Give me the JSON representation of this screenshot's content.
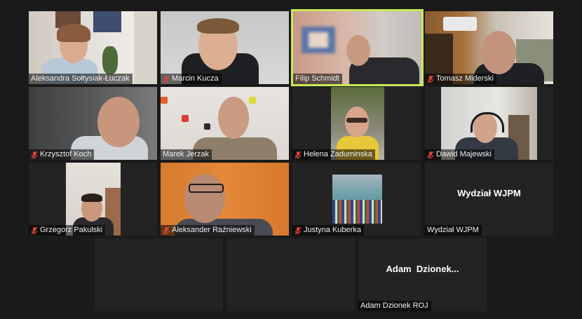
{
  "participants": [
    {
      "name": "Aleksandra Sołtysiak-Łuczak",
      "muted": false,
      "speaking": false
    },
    {
      "name": "Marcin Kucza",
      "muted": true,
      "speaking": false
    },
    {
      "name": "Filip Schmidt",
      "muted": false,
      "speaking": true
    },
    {
      "name": "Tomasz Miderski",
      "muted": true,
      "speaking": false
    },
    {
      "name": "Krzysztof Koch",
      "muted": true,
      "speaking": false
    },
    {
      "name": "Marek Jerzak",
      "muted": false,
      "speaking": false
    },
    {
      "name": "Helena Zaduminska",
      "muted": true,
      "speaking": false
    },
    {
      "name": "Dawid Majewski",
      "muted": true,
      "speaking": false
    },
    {
      "name": "Grzegorz Pakulski",
      "muted": true,
      "speaking": false
    },
    {
      "name": "Aleksander Raźniewski",
      "muted": true,
      "speaking": false
    },
    {
      "name": "Justyna Kuberka",
      "muted": true,
      "speaking": false
    },
    {
      "name": "Wydział WJPM",
      "muted": false,
      "speaking": false,
      "display_name": "Wydział WJPM"
    },
    {
      "name": "",
      "muted": false,
      "speaking": false
    },
    {
      "name": "",
      "muted": false,
      "speaking": false
    },
    {
      "name": "Adam Dzionek ROJ",
      "muted": false,
      "speaking": false,
      "display_name": "Adam  Dzionek..."
    }
  ],
  "colors": {
    "background": "#1a1a1a",
    "tile": "#232323",
    "active_speaker_border": "#c8e85a",
    "muted_icon": "#e0453a"
  }
}
